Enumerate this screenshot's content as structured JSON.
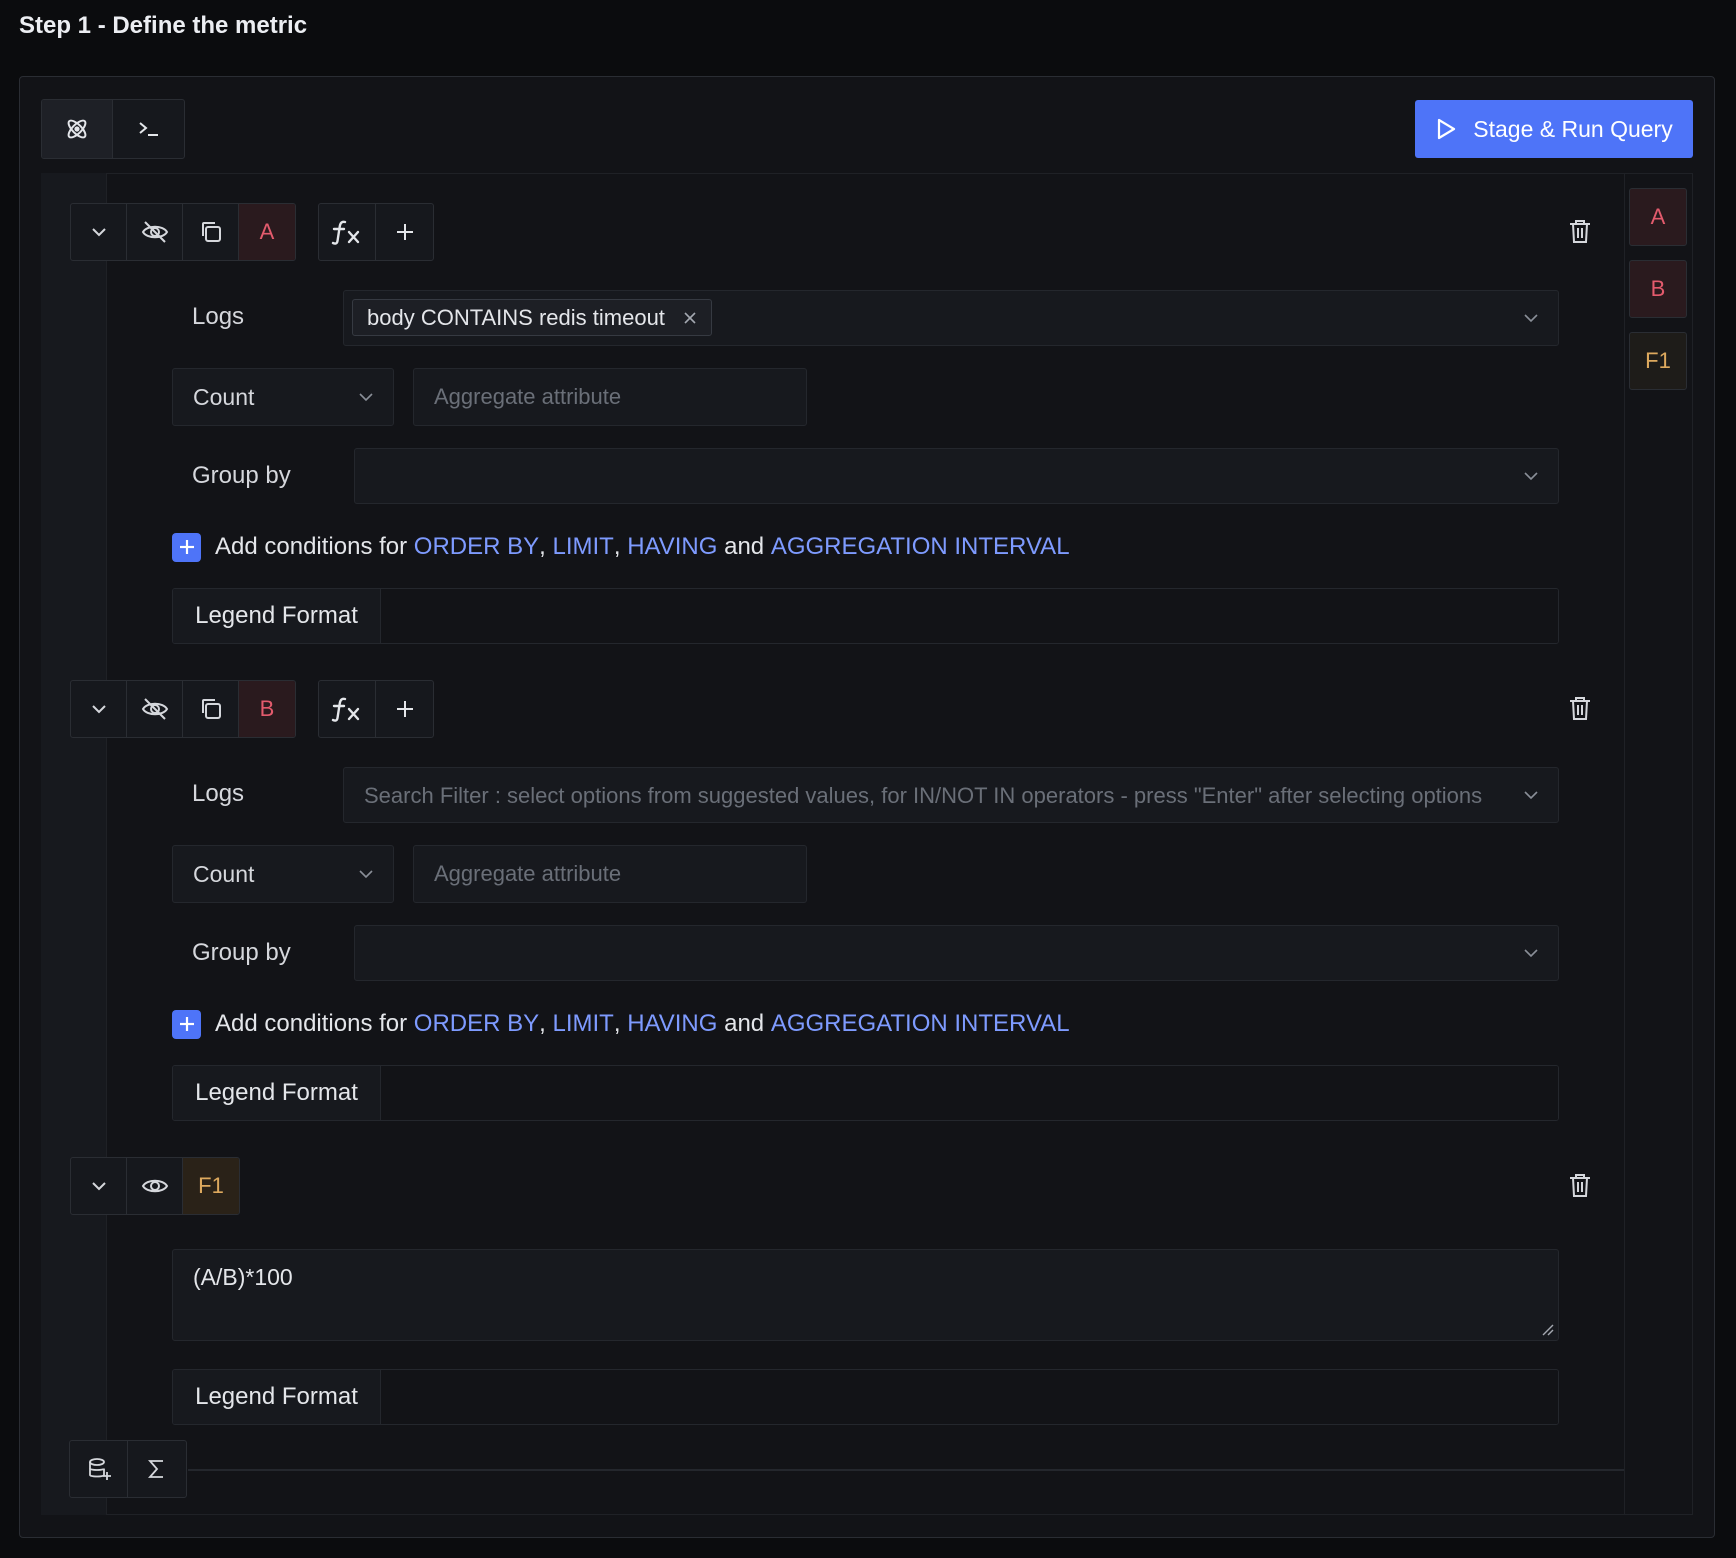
{
  "page": {
    "step_title": "Step 1 - Define the metric"
  },
  "toolbar": {
    "run_button_label": "Stage & Run Query",
    "modes": [
      {
        "name": "query-builder",
        "icon": "atom-icon"
      },
      {
        "name": "query-editor",
        "icon": "terminal-icon"
      }
    ]
  },
  "queries": [
    {
      "name": "A",
      "data_source": "Logs",
      "filter_tag": "body CONTAINS redis timeout",
      "filter_placeholder": "",
      "aggregate_operator": "Count",
      "aggregate_attribute_placeholder": "Aggregate attribute",
      "group_by_label": "Group by",
      "conditions": {
        "prefix": "Add conditions for ",
        "order_by": "ORDER BY",
        "limit": "LIMIT",
        "having": "HAVING",
        "and": " and ",
        "interval": "AGGREGATION INTERVAL"
      },
      "legend_label": "Legend Format"
    },
    {
      "name": "B",
      "data_source": "Logs",
      "filter_tag": "",
      "filter_placeholder": "Search Filter : select options from suggested values, for IN/NOT IN operators - press \"Enter\" after selecting options",
      "aggregate_operator": "Count",
      "aggregate_attribute_placeholder": "Aggregate attribute",
      "group_by_label": "Group by",
      "conditions": {
        "prefix": "Add conditions for ",
        "order_by": "ORDER BY",
        "limit": "LIMIT",
        "having": "HAVING",
        "and": " and ",
        "interval": "AGGREGATION INTERVAL"
      },
      "legend_label": "Legend Format"
    }
  ],
  "formula": {
    "name": "F1",
    "expression": "(A/B)*100",
    "legend_label": "Legend Format"
  },
  "side_tabs": [
    "A",
    "B",
    "F1"
  ],
  "colors": {
    "accent": "#4e74f8",
    "query_name": "#e35b6d",
    "formula_name": "#dda95e",
    "keyword": "#7e9bff"
  }
}
